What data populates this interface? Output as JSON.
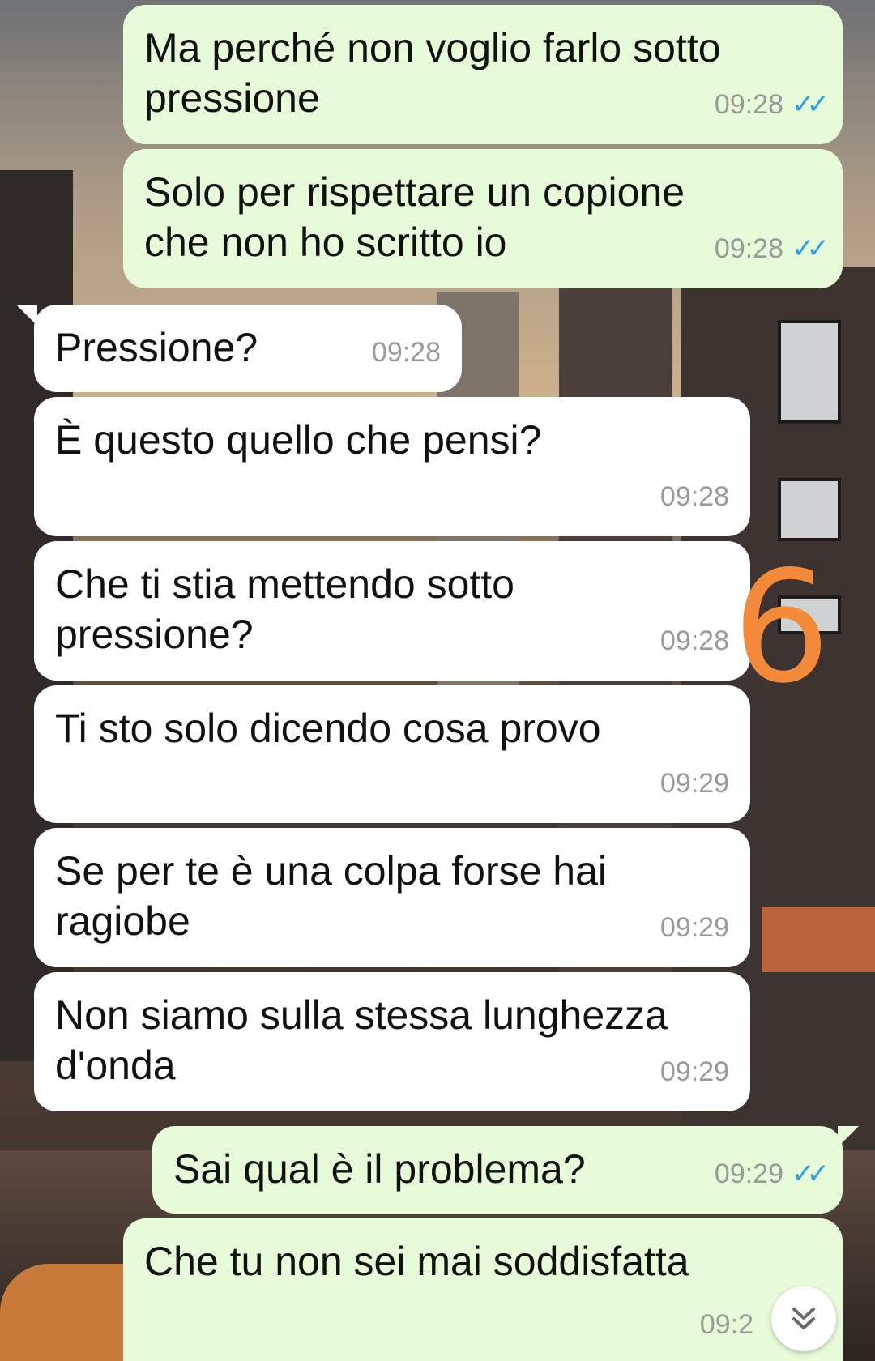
{
  "background": {
    "style": "city-street-wallpaper"
  },
  "messages": [
    {
      "direction": "out",
      "text": "Ma perché non voglio farlo sotto\npressione",
      "time": "09:28",
      "status": "read"
    },
    {
      "direction": "out",
      "text": "Solo per rispettare un copione\nche non ho scritto io",
      "time": "09:28",
      "status": "read"
    },
    {
      "direction": "in",
      "text": "Pressione?",
      "time": "09:28"
    },
    {
      "direction": "in",
      "text": "È questo quello che pensi?",
      "time": "09:28"
    },
    {
      "direction": "in",
      "text": "Che ti stia mettendo sotto\npressione?",
      "time": "09:28"
    },
    {
      "direction": "in",
      "text": "Ti sto solo dicendo cosa provo",
      "time": "09:29"
    },
    {
      "direction": "in",
      "text": "Se per te è una colpa forse hai\nragiobe",
      "time": "09:29"
    },
    {
      "direction": "in",
      "text": "Non siamo sulla stessa lunghezza\nd'onda",
      "time": "09:29"
    },
    {
      "direction": "out",
      "text": "Sai qual è il problema?",
      "time": "09:29",
      "status": "read"
    },
    {
      "direction": "out",
      "text": "Che tu non sei mai soddisfatta",
      "time": "09:2",
      "status": ""
    }
  ],
  "annotation": {
    "text": "6",
    "color": "#f28a3a"
  },
  "scroll_button": {
    "icon": "double-chevron-down-icon"
  },
  "colors": {
    "outgoing_bubble": "#e7fbd8",
    "incoming_bubble": "#ffffff",
    "read_ticks": "#2ea0e8",
    "timestamp": "#9a9a9a"
  }
}
